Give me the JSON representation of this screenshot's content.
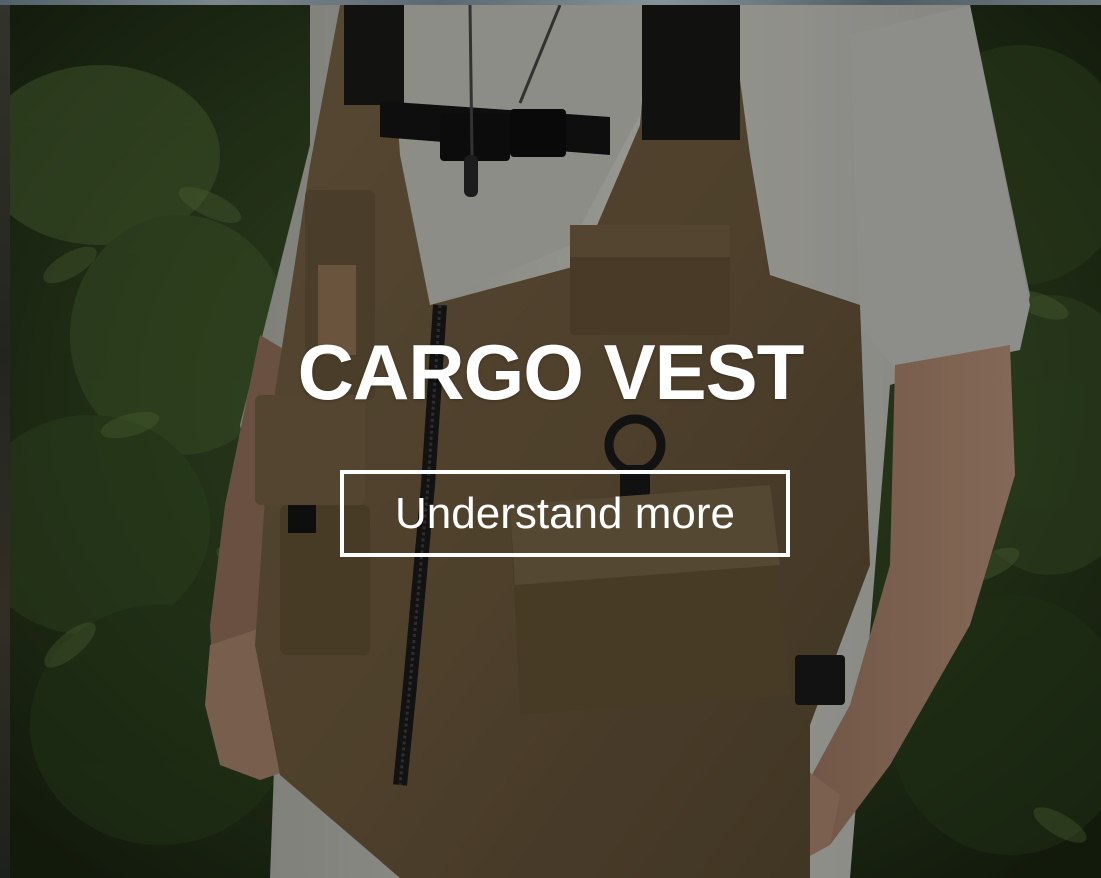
{
  "hero": {
    "title": "CARGO VEST",
    "cta_label": "Understand more"
  },
  "colors": {
    "text": "#ffffff",
    "vest": "#7a6647",
    "foliage": "#3f5b2a",
    "shirt": "#d6d6cf"
  }
}
